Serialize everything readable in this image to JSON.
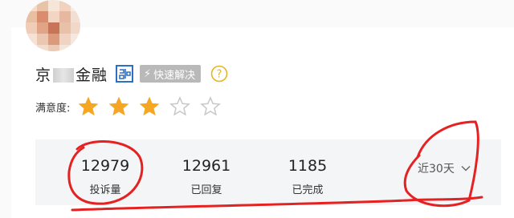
{
  "company": {
    "name_prefix": "京",
    "name_suffix": "金融",
    "badge_label": "快速解决"
  },
  "rating": {
    "label": "满意度:",
    "value": 3,
    "max": 5,
    "filled_color": "#f5a623",
    "empty_color": "#c8c8c8"
  },
  "stats": [
    {
      "value": "12979",
      "label": "投诉量"
    },
    {
      "value": "12961",
      "label": "已回复"
    },
    {
      "value": "1185",
      "label": "已完成"
    }
  ],
  "period": {
    "label": "近30天"
  },
  "colors": {
    "brand_blue": "#2f6fc1",
    "help_yellow": "#e6b422",
    "annotation_red": "#e52222"
  },
  "icons": {
    "brand": "brand-logo-icon",
    "badge": "lightning-icon",
    "help": "question-mark-icon",
    "dropdown": "chevron-down-icon"
  }
}
